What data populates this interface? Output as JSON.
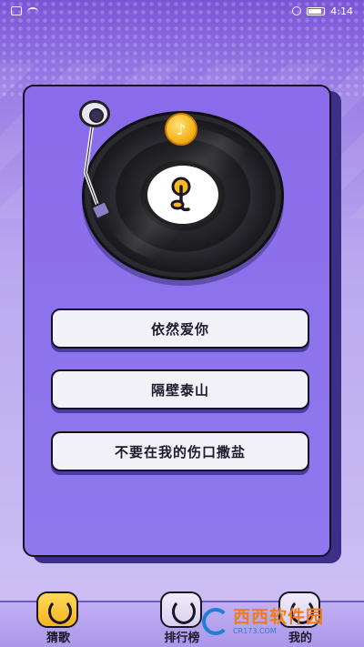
{
  "status_bar": {
    "time": "4:14"
  },
  "game": {
    "coin_icon": "music-coin-icon",
    "record_icon": "music-note-icon",
    "answers": [
      {
        "label": "依然爱你"
      },
      {
        "label": "隔壁泰山"
      },
      {
        "label": "不要在我的伤口撒盐"
      }
    ]
  },
  "bottom_nav": {
    "items": [
      {
        "label": "猜歌",
        "icon": "music-note-icon",
        "active": true
      },
      {
        "label": "排行榜",
        "icon": "ranking-icon",
        "active": false
      },
      {
        "label": "我的",
        "icon": "profile-icon",
        "active": false
      }
    ]
  },
  "watermark": {
    "title": "西西软件园",
    "subtitle": "CR173.COM"
  },
  "colors": {
    "card": "#8a6bea",
    "card_border": "#151027",
    "coin": "#f8b820",
    "answer_bg": "#f3f1f8"
  }
}
